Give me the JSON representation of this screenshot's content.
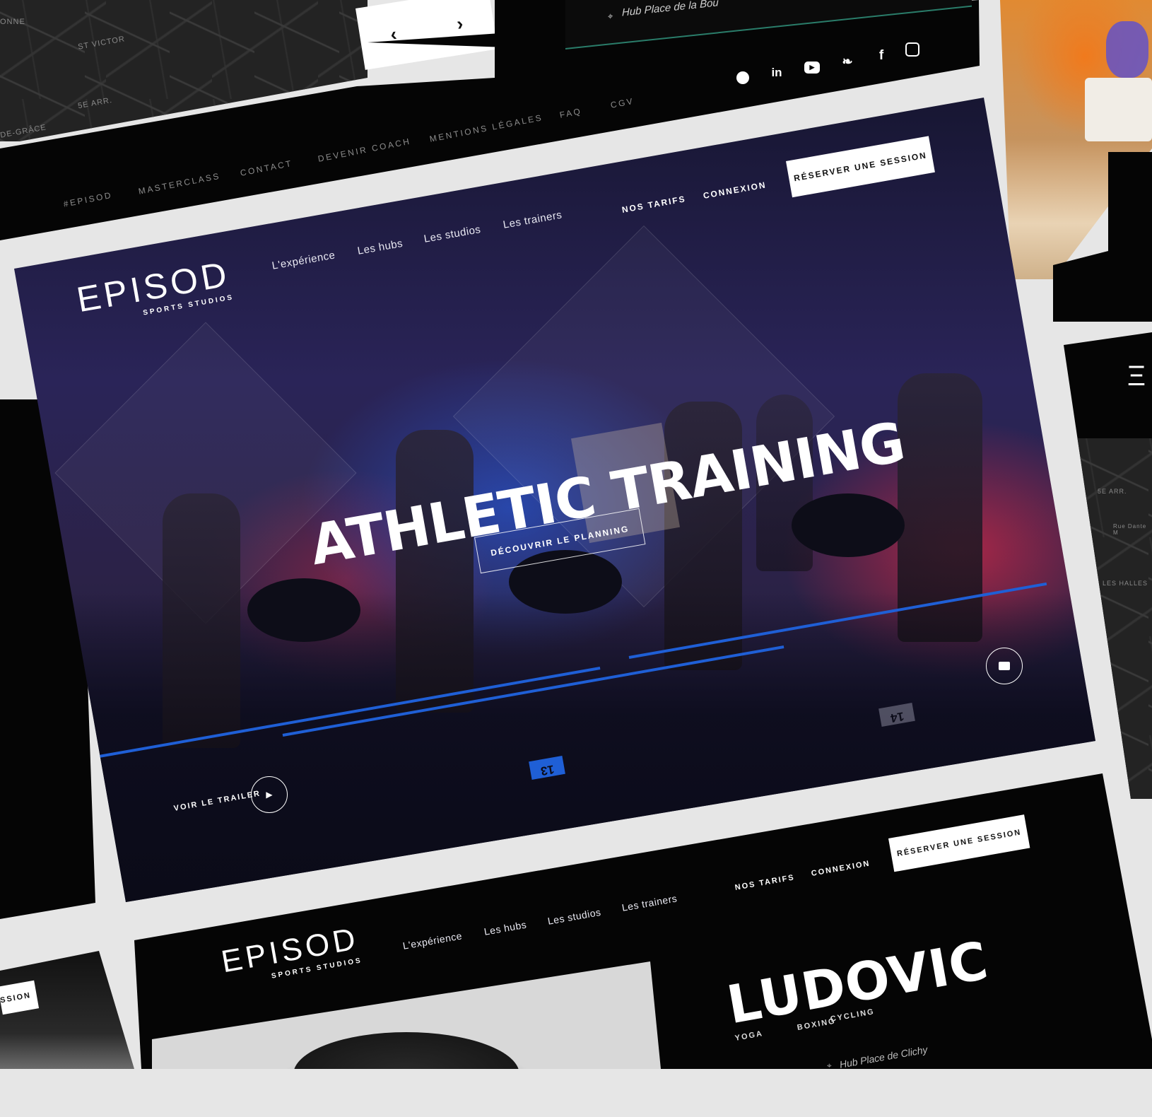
{
  "top_map": {
    "labels": [
      "ST VICTOR",
      "5E ARR.",
      "ONNE",
      "DE-GRÂCE"
    ],
    "arrows": {
      "prev": "‹",
      "next": "›"
    }
  },
  "top_info": {
    "address": "Hub Place de la Bou"
  },
  "social": [
    "spotify-icon",
    "linkedin-icon",
    "youtube-icon",
    "twitter-icon",
    "facebook-icon",
    "instagram-icon"
  ],
  "footer_links": [
    "#EPISOD",
    "MASTERCLASS",
    "CONTACT",
    "DEVENIR COACH",
    "MENTIONS LÉGALES",
    "FAQ",
    "CGV"
  ],
  "hero": {
    "logo": "EPISOD",
    "logo_sub": "SPORTS STUDIOS",
    "nav": [
      "L'expérience",
      "Les hubs",
      "Les studios",
      "Les trainers"
    ],
    "tarifs": "NOS TARIFS",
    "connexion": "CONNEXION",
    "cta": "RÉSERVER UNE SESSION",
    "title": "ATHLETIC TRAINING",
    "planning": "DÉCOUVRIR LE PLANNING",
    "trailer": "VOIR LE TRAILER",
    "floor_numbers": [
      "13",
      "14"
    ]
  },
  "trainer_page": {
    "logo": "EPISOD",
    "logo_sub": "SPORTS STUDIOS",
    "nav": [
      "L'expérience",
      "Les hubs",
      "Les studios",
      "Les trainers"
    ],
    "tarifs": "NOS TARIFS",
    "connexion": "CONNEXION",
    "cta": "RÉSERVER UNE SESSION",
    "name": "LUDOVIC",
    "tags": [
      "YOGA",
      "BOXING",
      "CYCLING"
    ],
    "hub": "Hub Place de Clichy"
  },
  "left_partial": {
    "cta_fragment": "SSION"
  },
  "right_map": {
    "labels": [
      "5E ARR.",
      "LES HALLES",
      "Rue Dante M"
    ]
  },
  "colors": {
    "accent_blue": "#1f5fd6",
    "accent_red": "#d22846",
    "panel": "#050505",
    "bg": "#e6e6e6"
  }
}
